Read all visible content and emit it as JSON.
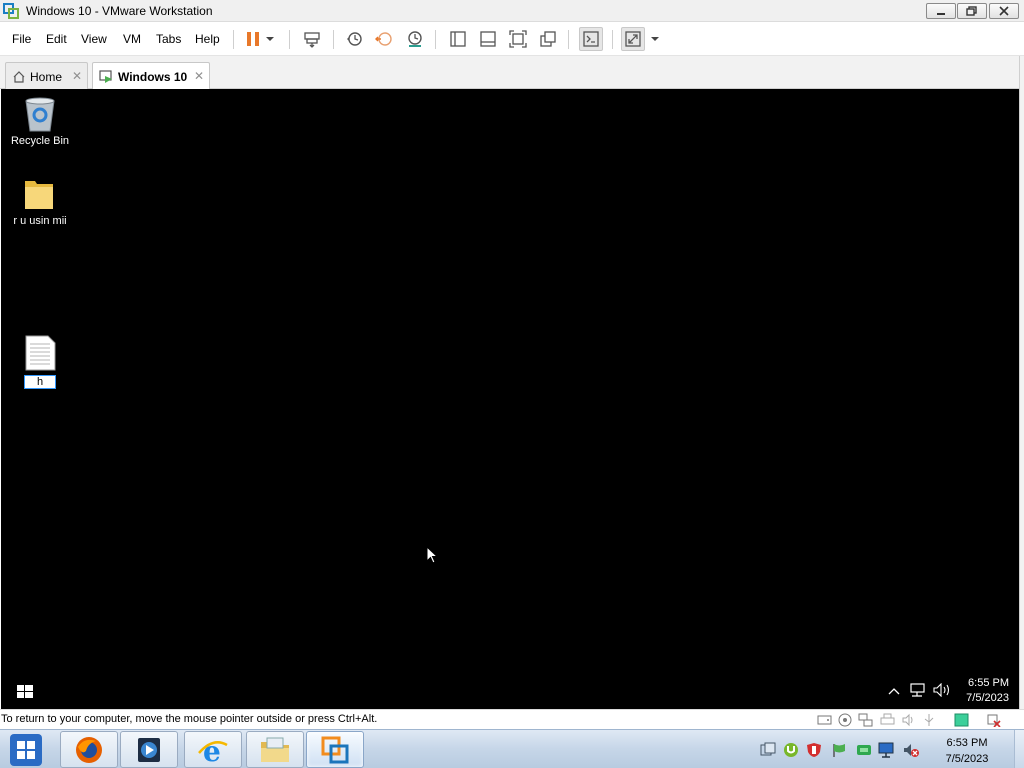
{
  "window": {
    "title": "Windows 10 - VMware Workstation",
    "icon": "vmware-icon"
  },
  "menu": {
    "items": [
      "File",
      "Edit",
      "View",
      "VM",
      "Tabs",
      "Help"
    ]
  },
  "toolbar": {
    "buttons": [
      "pause-icon",
      "dropdown-arrow-icon",
      "send-ctrl-alt-del-icon",
      "snapshot-icon",
      "revert-snapshot-icon",
      "snapshot-manager-icon",
      "library-view-icon",
      "thumbnail-bar-icon",
      "full-screen-icon",
      "unity-icon",
      "console-view-icon",
      "stretch-guest-icon",
      "dropdown-arrow-icon"
    ],
    "accent_pause": "#e8782a"
  },
  "tabs": [
    {
      "label": "Home",
      "icon": "home-icon",
      "active": false
    },
    {
      "label": "Windows 10",
      "icon": "vm-running-icon",
      "active": true
    }
  ],
  "guest": {
    "desktop_icons": [
      {
        "label": "Recycle Bin",
        "icon": "recycle-bin-icon"
      },
      {
        "label": "r u usin mii",
        "icon": "folder-icon"
      },
      {
        "label": "h",
        "icon": "text-document-icon"
      }
    ],
    "taskbar": {
      "start_icon": "windows-start-icon",
      "tray_icons": [
        "chevron-up-icon",
        "network-icon",
        "volume-icon"
      ],
      "time": "6:55 PM",
      "date": "7/5/2023"
    },
    "background": "#000000"
  },
  "statusbar": {
    "message": "To return to your computer, move the mouse pointer outside or press Ctrl+Alt.",
    "device_icons": [
      "hard-disk-icon",
      "cd-dvd-icon",
      "network-adapter-icon",
      "printer-icon",
      "sound-card-icon",
      "usb-icon",
      "notes-icon",
      "disconnect-icon"
    ]
  },
  "host_taskbar": {
    "apps": [
      "firefox-icon",
      "media-player-icon",
      "internet-explorer-icon",
      "file-explorer-icon",
      "vmware-icon"
    ],
    "tray_icons": [
      "action-center-icon",
      "utorrent-icon",
      "antivirus-icon",
      "flag-icon",
      "green-app-icon",
      "network-icon",
      "volume-muted-icon"
    ],
    "time": "6:53 PM",
    "date": "7/5/2023"
  }
}
